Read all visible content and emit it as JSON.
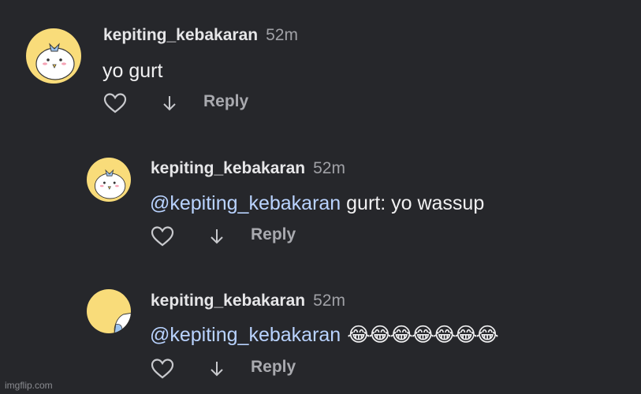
{
  "comments": [
    {
      "username": "kepiting_kebakaran",
      "time": "52m",
      "text": "yo gurt",
      "reply_label": "Reply",
      "avatar_icon": "cartoon-avatar"
    },
    {
      "username": "kepiting_kebakaran",
      "time": "52m",
      "mention": "@kepiting_kebakaran",
      "text": " gurt: yo wassup",
      "reply_label": "Reply",
      "avatar_icon": "cartoon-avatar"
    },
    {
      "username": "kepiting_kebakaran",
      "time": "52m",
      "mention": "@kepiting_kebakaran",
      "emojis": "😂😂😂😂😂😂😂",
      "reply_label": "Reply",
      "avatar_icon": "cartoon-avatar-partial"
    }
  ],
  "watermark": "imgflip.com",
  "colors": {
    "background": "#26272b",
    "mention": "#b9d3ff",
    "avatar_bg": "#f9dc7a",
    "muted": "#a0a1a6"
  }
}
